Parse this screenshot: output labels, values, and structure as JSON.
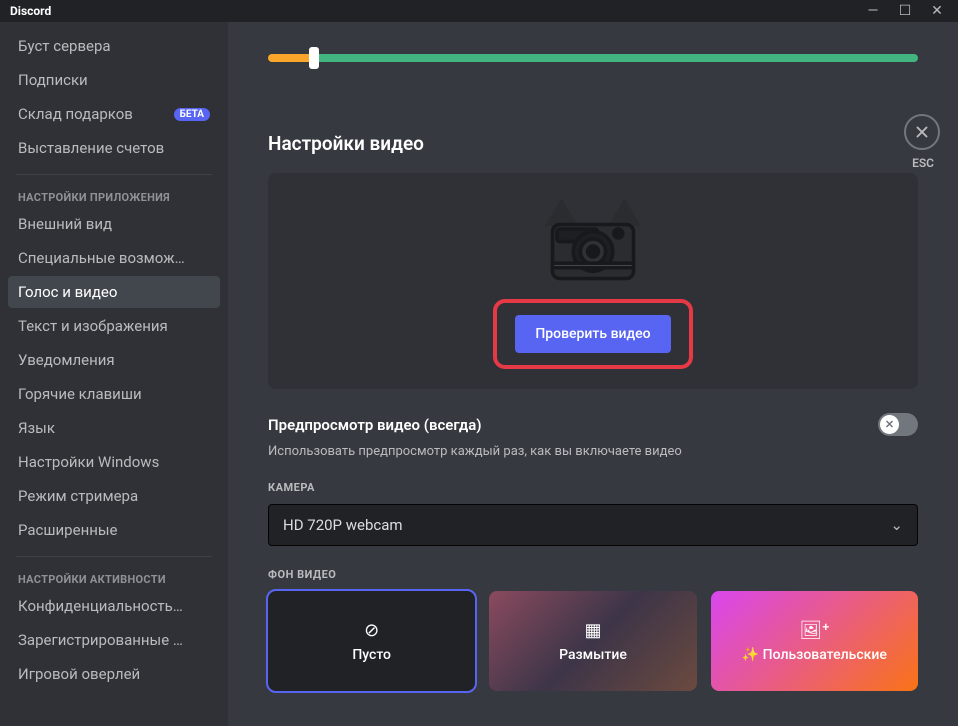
{
  "titlebar": {
    "title": "Discord"
  },
  "close": {
    "esc": "ESC"
  },
  "sidebar": {
    "items_top": [
      "Буст сервера",
      "Подписки",
      "Склад подарков",
      "Выставление счетов"
    ],
    "beta_badge": "БЕТА",
    "header_app": "НАСТРОЙКИ ПРИЛОЖЕНИЯ",
    "items_app": [
      "Внешний вид",
      "Специальные возмож…",
      "Голос и видео",
      "Текст и изображения",
      "Уведомления",
      "Горячие клавиши",
      "Язык",
      "Настройки Windows",
      "Режим стримера",
      "Расширенные"
    ],
    "header_activity": "НАСТРОЙКИ АКТИВНОСТИ",
    "items_activity": [
      "Конфиденциальность…",
      "Зарегистрированные …",
      "Игровой оверлей"
    ]
  },
  "content": {
    "section_title": "Настройки видео",
    "test_video_btn": "Проверить видео",
    "preview_label": "Предпросмотр видео (всегда)",
    "preview_desc": "Использовать предпросмотр каждый раз, как вы включаете видео",
    "camera_header": "КАМЕРА",
    "camera_value": "HD 720P webcam",
    "bg_header": "ФОН ВИДЕО",
    "bg_options": {
      "none": "Пусто",
      "blur": "Размытие",
      "custom": "Пользовательские"
    }
  }
}
